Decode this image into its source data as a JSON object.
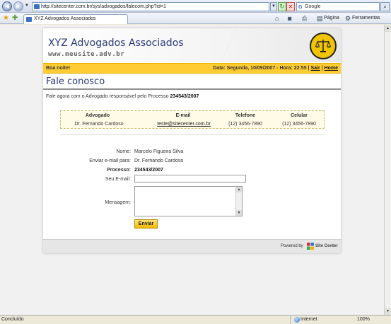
{
  "browser": {
    "url": "http://sitecenter.com.br/sys/advogados/falecom.php?id=1",
    "search_placeholder": "Google",
    "tab_title": "XYZ Advogados Associados",
    "tools": {
      "page": "Página",
      "tools": "Ferramentas"
    },
    "status": "Concluído",
    "zone": "Internet",
    "zoom": "100%"
  },
  "site": {
    "title": "XYZ Advogados Associados",
    "url": "www.meusite.adv.br",
    "greeting": "Boa noite!",
    "date_prefix": "Data:",
    "date": "Segunda, 10/09/2007",
    "time_prefix": "- Hora:",
    "time": "22:55",
    "logout": "Sair",
    "home": "Home"
  },
  "page": {
    "heading": "Fale conosco",
    "intro_text": "Fale agora com o Advogado responsável pelo Processo",
    "intro_process": "234543/2007"
  },
  "contact": {
    "headers": [
      "Advogado",
      "E-mail",
      "Telefone",
      "Celular"
    ],
    "values": [
      "Dr. Fernando Cardoso",
      "teste@sitecenter.com.br",
      "(12) 3456-7890",
      "(12) 3456-7890"
    ]
  },
  "form": {
    "name_label": "Nome:",
    "name_value": "Marcelo Figueira Silva",
    "send_to_label": "Enviar e-mail para:",
    "send_to_value": "Dr. Fernando Cardoso",
    "process_label": "Processo:",
    "process_value": "234543/2007",
    "email_label": "Seu E-mail:",
    "email_value": "",
    "message_label": "Mensagem:",
    "message_value": "",
    "submit_label": "Enviar"
  },
  "footer": {
    "powered_by": "Powered by",
    "brand": "Site Center"
  }
}
